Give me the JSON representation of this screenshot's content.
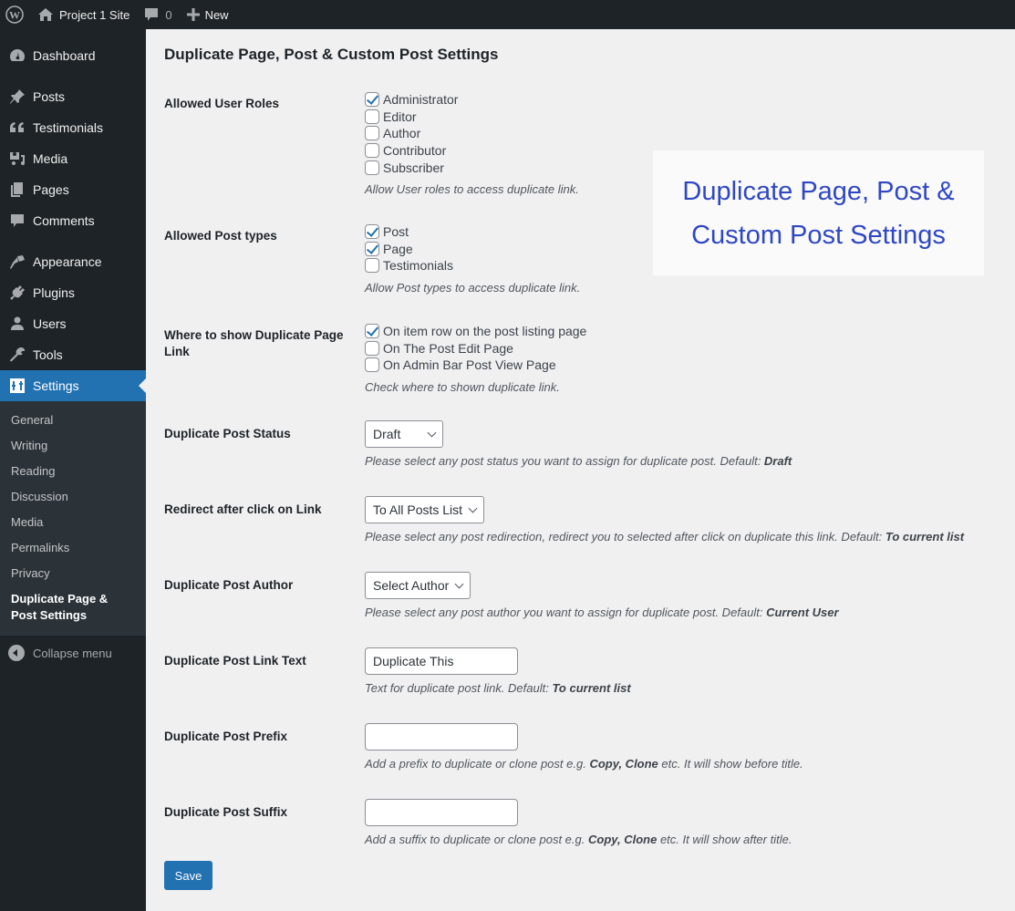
{
  "adminbar": {
    "site_name": "Project 1 Site",
    "comments_count": "0",
    "new_label": "New"
  },
  "sidebar": {
    "items": [
      {
        "label": "Dashboard",
        "icon": "dashboard-icon"
      },
      {
        "label": "Posts",
        "icon": "pin-icon"
      },
      {
        "label": "Testimonials",
        "icon": "quote-icon"
      },
      {
        "label": "Media",
        "icon": "media-icon"
      },
      {
        "label": "Pages",
        "icon": "pages-icon"
      },
      {
        "label": "Comments",
        "icon": "comment-icon"
      },
      {
        "label": "Appearance",
        "icon": "brush-icon"
      },
      {
        "label": "Plugins",
        "icon": "plug-icon"
      },
      {
        "label": "Users",
        "icon": "user-icon"
      },
      {
        "label": "Tools",
        "icon": "wrench-icon"
      },
      {
        "label": "Settings",
        "icon": "sliders-icon"
      }
    ],
    "submenu": [
      "General",
      "Writing",
      "Reading",
      "Discussion",
      "Media",
      "Permalinks",
      "Privacy",
      "Duplicate Page & Post Settings"
    ],
    "collapse_label": "Collapse menu"
  },
  "page": {
    "title": "Duplicate Page, Post & Custom Post Settings",
    "banner_line1": "Duplicate Page, Post &",
    "banner_line2": "Custom Post Settings",
    "save_label": "Save"
  },
  "settings": {
    "user_roles": {
      "label": "Allowed User Roles",
      "options": [
        {
          "label": "Administrator",
          "checked": true
        },
        {
          "label": "Editor",
          "checked": false
        },
        {
          "label": "Author",
          "checked": false
        },
        {
          "label": "Contributor",
          "checked": false
        },
        {
          "label": "Subscriber",
          "checked": false
        }
      ],
      "description": "Allow User roles to access duplicate link."
    },
    "post_types": {
      "label": "Allowed Post types",
      "options": [
        {
          "label": "Post",
          "checked": true
        },
        {
          "label": "Page",
          "checked": true
        },
        {
          "label": "Testimonials",
          "checked": false
        }
      ],
      "description": "Allow Post types to access duplicate link."
    },
    "where_show": {
      "label": "Where to show Duplicate Page Link",
      "options": [
        {
          "label": "On item row on the post listing page",
          "checked": true
        },
        {
          "label": "On The Post Edit Page",
          "checked": false
        },
        {
          "label": "On Admin Bar Post View Page",
          "checked": false
        }
      ],
      "description": "Check where to shown duplicate link."
    },
    "post_status": {
      "label": "Duplicate Post Status",
      "value": "Draft",
      "description": "Please select any post status you want to assign for duplicate post. Default: ",
      "default": "Draft"
    },
    "redirect": {
      "label": "Redirect after click on Link",
      "value": "To All Posts List",
      "description": "Please select any post redirection, redirect you to selected after click on duplicate this link. Default: ",
      "default": "To current list"
    },
    "author": {
      "label": "Duplicate Post Author",
      "value": "Select Author",
      "description": "Please select any post author you want to assign for duplicate post. Default: ",
      "default": "Current User"
    },
    "link_text": {
      "label": "Duplicate Post Link Text",
      "value": "Duplicate This",
      "description": "Text for duplicate post link. Default: ",
      "default": "To current list"
    },
    "prefix": {
      "label": "Duplicate Post Prefix",
      "value": "",
      "desc_before": "Add a prefix to duplicate or clone post e.g. ",
      "desc_bold": "Copy, Clone",
      "desc_after": " etc. It will show before title."
    },
    "suffix": {
      "label": "Duplicate Post Suffix",
      "value": "",
      "desc_before": "Add a suffix to duplicate or clone post e.g. ",
      "desc_bold": "Copy, Clone",
      "desc_after": " etc. It will show after title."
    }
  }
}
